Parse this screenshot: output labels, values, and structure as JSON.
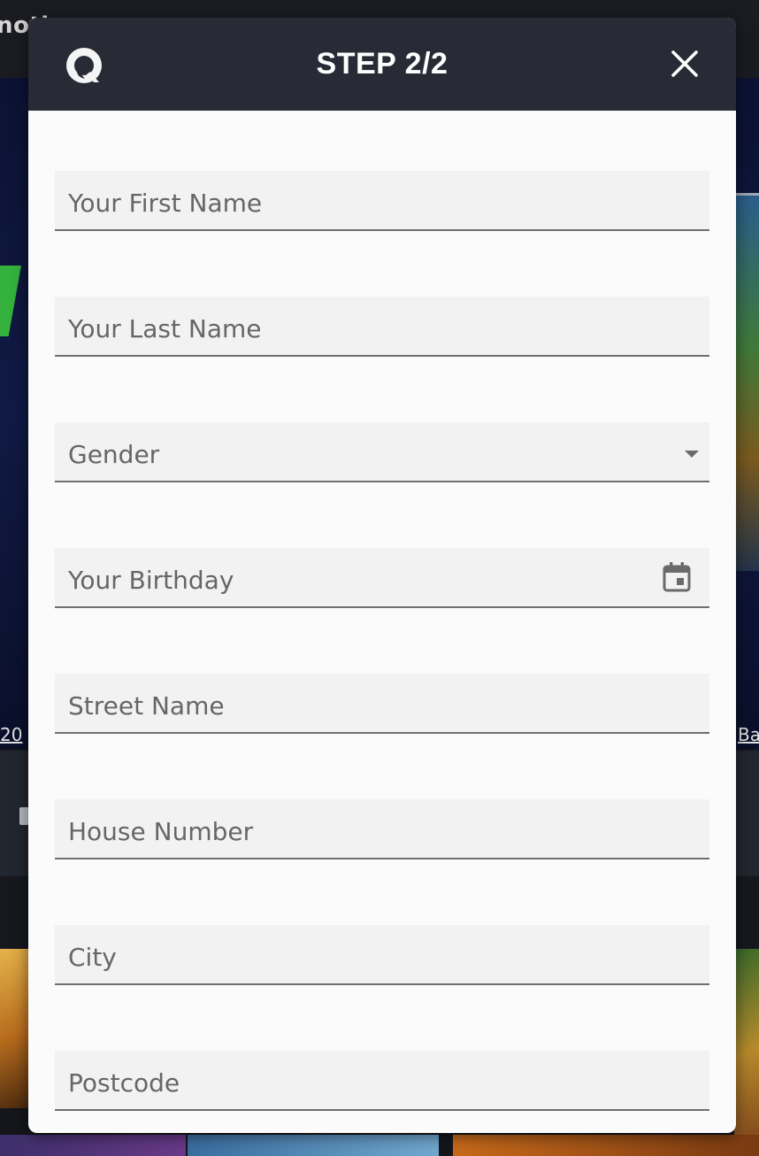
{
  "background": {
    "topbar_text": "noti",
    "caption_left": "20",
    "caption_right": "Ba"
  },
  "modal": {
    "title": "STEP 2/2",
    "header_icons": {
      "left": "support-chat-icon",
      "right": "close-icon"
    },
    "colors": {
      "header_bg": "#282a35",
      "body_bg": "#fbfbfb",
      "field_bg": "#f2f2f2",
      "label_text": "#666666",
      "underline": "#6f6f6f"
    },
    "fields": [
      {
        "label": "Your First Name",
        "type": "text"
      },
      {
        "label": "Your Last Name",
        "type": "text"
      },
      {
        "label": "Gender",
        "type": "select",
        "icon": "dropdown-arrow-icon"
      },
      {
        "label": "Your Birthday",
        "type": "date",
        "icon": "calendar-icon"
      },
      {
        "label": "Street Name",
        "type": "text"
      },
      {
        "label": "House Number",
        "type": "text"
      },
      {
        "label": "City",
        "type": "text"
      },
      {
        "label": "Postcode",
        "type": "text"
      }
    ]
  }
}
